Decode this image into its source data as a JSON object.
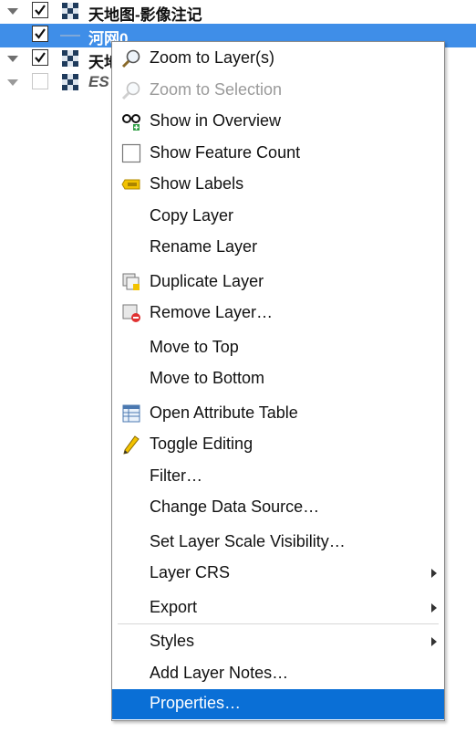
{
  "layer_tree": {
    "layers": [
      {
        "name": "天地图-影像注记",
        "checked": true,
        "icon": "raster-icon"
      },
      {
        "name": "河网0",
        "checked": true,
        "icon": "line-icon",
        "selected": true
      },
      {
        "name": "天地",
        "checked": true,
        "icon": "raster-icon"
      },
      {
        "name": "ES",
        "checked": false,
        "icon": "raster-icon"
      }
    ]
  },
  "context_menu": {
    "items": [
      {
        "label": "Zoom to Layer(s)",
        "icon": "zoom-layer-icon",
        "enabled": true
      },
      {
        "label": "Zoom to Selection",
        "icon": "zoom-selection-icon",
        "enabled": false
      },
      {
        "label": "Show in Overview",
        "icon": "overview-glasses-icon",
        "enabled": true
      },
      {
        "label": "Show Feature Count",
        "icon": "feature-count-checkbox-icon",
        "enabled": true
      },
      {
        "label": "Show Labels",
        "icon": "labels-abc-icon",
        "enabled": true
      },
      {
        "label": "Copy Layer",
        "enabled": true
      },
      {
        "label": "Rename Layer",
        "enabled": true
      },
      {
        "label": "Duplicate Layer",
        "icon": "duplicate-layer-icon",
        "enabled": true
      },
      {
        "label": "Remove Layer…",
        "icon": "remove-layer-icon",
        "enabled": true
      },
      {
        "label": "Move to Top",
        "enabled": true
      },
      {
        "label": "Move to Bottom",
        "enabled": true
      },
      {
        "label": "Open Attribute Table",
        "icon": "attribute-table-icon",
        "enabled": true
      },
      {
        "label": "Toggle Editing",
        "icon": "pencil-icon",
        "enabled": true
      },
      {
        "label": "Filter…",
        "enabled": true
      },
      {
        "label": "Change Data Source…",
        "enabled": true
      },
      {
        "label": "Set Layer Scale Visibility…",
        "enabled": true
      },
      {
        "label": "Layer CRS",
        "submenu": true,
        "enabled": true
      },
      {
        "label": "Export",
        "submenu": true,
        "enabled": true
      },
      {
        "label": "Styles",
        "submenu": true,
        "enabled": true
      },
      {
        "label": "Add Layer Notes…",
        "enabled": true
      },
      {
        "label": "Properties…",
        "highlighted": true,
        "enabled": true
      }
    ]
  }
}
